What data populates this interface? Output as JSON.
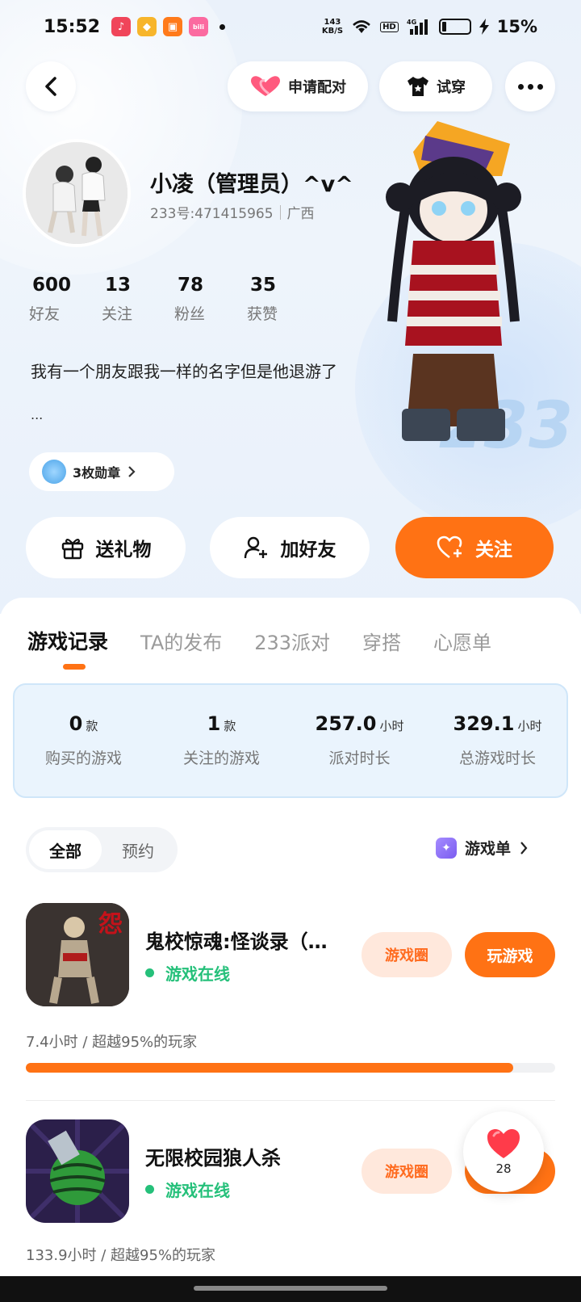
{
  "status_bar": {
    "time": "15:52",
    "net_speed_value": "143",
    "net_speed_unit": "KB/S",
    "hd": "HD",
    "signal_label": "4G",
    "battery_pct": "15%",
    "battery_level": 0.15
  },
  "nav": {
    "pair_label": "申请配对",
    "try_label": "试穿"
  },
  "profile": {
    "nickname": "小凌（管理员）^v^",
    "uid": "233号:471415965",
    "region": "广西",
    "stats": [
      {
        "num": "600",
        "label": "好友"
      },
      {
        "num": "13",
        "label": "关注"
      },
      {
        "num": "78",
        "label": "粉丝"
      },
      {
        "num": "35",
        "label": "获赞"
      }
    ],
    "bio": "我有一个朋友跟我一样的名字但是他退游了",
    "bio_more": "...",
    "medal_label": "3枚勋章"
  },
  "actions": {
    "gift": "送礼物",
    "add_friend": "加好友",
    "follow": "关注"
  },
  "tabs": [
    "游戏记录",
    "TA的发布",
    "233派对",
    "穿搭",
    "心愿单"
  ],
  "summary": [
    {
      "value": "0",
      "unit": "款",
      "label": "购买的游戏"
    },
    {
      "value": "1",
      "unit": "款",
      "label": "关注的游戏"
    },
    {
      "value": "257.0",
      "unit": "小时",
      "label": "派对时长"
    },
    {
      "value": "329.1",
      "unit": "小时",
      "label": "总游戏时长"
    }
  ],
  "filter": {
    "all": "全部",
    "reserve": "预约",
    "gamelist": "游戏单"
  },
  "games": [
    {
      "title": "鬼校惊魂:怪谈录（…",
      "status": "游戏在线",
      "circle_btn": "游戏圈",
      "play_btn": "玩游戏",
      "meta": "7.4小时 / 超越95%的玩家",
      "progress": 0.92
    },
    {
      "title": "无限校园狼人杀",
      "status": "游戏在线",
      "circle_btn": "游戏圈",
      "play_btn": "玩游戏",
      "meta": "133.9小时 / 超越95%的玩家"
    }
  ],
  "like_float": {
    "count": "28"
  },
  "colors": {
    "accent": "#ff7214",
    "online": "#25c07a"
  }
}
